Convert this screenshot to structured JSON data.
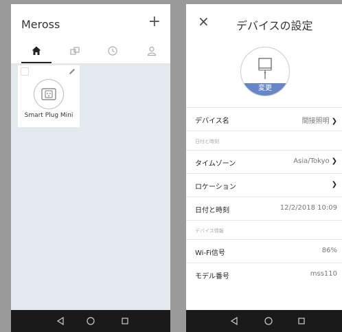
{
  "left": {
    "app_title": "Meross",
    "add_label": "+",
    "tabs": [
      {
        "icon": "home-icon",
        "active": true
      },
      {
        "icon": "rooms-icon",
        "active": false
      },
      {
        "icon": "clock-icon",
        "active": false
      },
      {
        "icon": "user-icon",
        "active": false
      }
    ],
    "device": {
      "name": "Smart Plug Mini",
      "icon": "smart-plug-icon"
    }
  },
  "right": {
    "title": "デバイスの設定",
    "close_label": "×",
    "change_label": "変更",
    "rows": [
      {
        "type": "row",
        "label": "デバイス名",
        "value": "間接照明",
        "chevron": true
      },
      {
        "type": "section",
        "label": "日付と時刻"
      },
      {
        "type": "row",
        "label": "タイムゾーン",
        "value": "Asia/Tokyo",
        "chevron": true
      },
      {
        "type": "row",
        "label": "ロケーション",
        "value": "",
        "chevron": true
      },
      {
        "type": "row",
        "label": "日付と時刻",
        "value": "12/2/2018 10:09",
        "chevron": false
      },
      {
        "type": "section",
        "label": "デバイス情報"
      },
      {
        "type": "row",
        "label": "Wi-Fi信号",
        "value": "86%",
        "chevron": false
      },
      {
        "type": "row",
        "label": "モデル番号",
        "value": "mss110",
        "chevron": false
      }
    ]
  },
  "navigation": [
    "back-icon",
    "home-circle-icon",
    "recents-icon"
  ],
  "colors": {
    "accent": "#6686c8",
    "home_background": "#e4e9f0",
    "nav_bar": "#1a1a1a"
  }
}
